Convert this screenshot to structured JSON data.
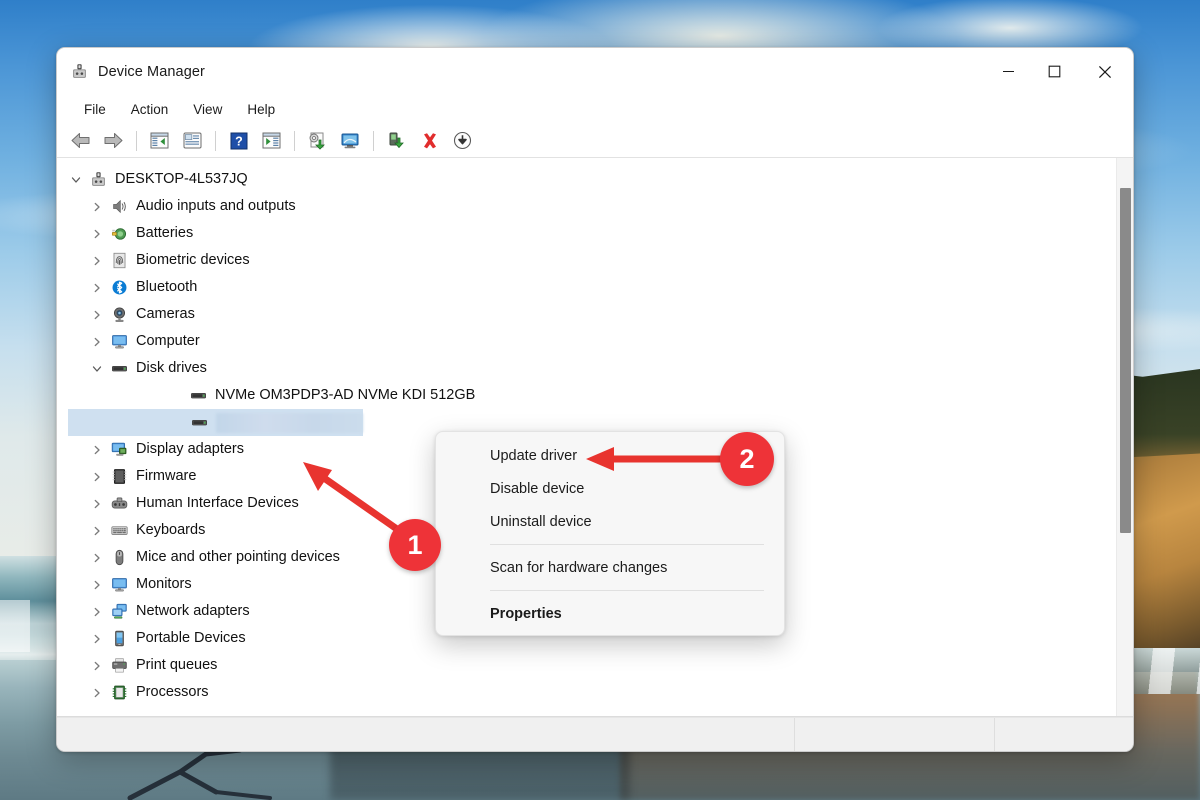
{
  "window": {
    "title": "Device Manager",
    "app_icon": "device-manager-icon",
    "controls": {
      "minimize": "–",
      "maximize": "□",
      "close": "✕"
    }
  },
  "menubar": {
    "items": [
      {
        "label": "File"
      },
      {
        "label": "Action"
      },
      {
        "label": "View"
      },
      {
        "label": "Help"
      }
    ]
  },
  "toolbar": {
    "buttons": [
      {
        "name": "back-icon",
        "title": "Back"
      },
      {
        "name": "forward-icon",
        "title": "Forward"
      },
      {
        "name": "show-hide-console-tree-icon",
        "title": "Show/Hide Console Tree"
      },
      {
        "name": "properties-icon",
        "title": "Properties"
      },
      {
        "name": "help-icon",
        "title": "Help"
      },
      {
        "name": "show-hide-action-pane-icon",
        "title": "Show/Hide Action Pane"
      },
      {
        "name": "update-driver-icon",
        "title": "Update Driver Software"
      },
      {
        "name": "scan-for-hardware-changes-icon",
        "title": "Scan for hardware changes"
      },
      {
        "name": "uninstall-device-icon",
        "title": "Uninstall device"
      },
      {
        "name": "disable-device-icon",
        "title": "Disable device"
      },
      {
        "name": "enable-device-icon",
        "title": "Enable device"
      }
    ]
  },
  "tree": {
    "root": {
      "label": "DESKTOP-4L537JQ",
      "icon": "computer-root-icon",
      "expanded": true
    },
    "nodes": [
      {
        "label": "Audio inputs and outputs",
        "icon": "speaker-icon",
        "expanded": false,
        "level": 1
      },
      {
        "label": "Batteries",
        "icon": "battery-icon",
        "expanded": false,
        "level": 1
      },
      {
        "label": "Biometric devices",
        "icon": "fingerprint-icon",
        "expanded": false,
        "level": 1
      },
      {
        "label": "Bluetooth",
        "icon": "bluetooth-icon",
        "expanded": false,
        "level": 1
      },
      {
        "label": "Cameras",
        "icon": "camera-icon",
        "expanded": false,
        "level": 1
      },
      {
        "label": "Computer",
        "icon": "monitor-icon",
        "expanded": false,
        "level": 1
      },
      {
        "label": "Disk drives",
        "icon": "disk-drive-icon",
        "expanded": true,
        "level": 1
      },
      {
        "label": "NVMe OM3PDP3-AD NVMe KDI 512GB",
        "icon": "disk-drive-icon",
        "level": 2,
        "leaf": true
      },
      {
        "label": "",
        "icon": "disk-drive-icon",
        "level": 2,
        "leaf": true,
        "selected": true,
        "redacted": true
      },
      {
        "label": "Display adapters",
        "icon": "display-adapter-icon",
        "expanded": false,
        "level": 1
      },
      {
        "label": "Firmware",
        "icon": "firmware-chip-icon",
        "expanded": false,
        "level": 1
      },
      {
        "label": "Human Interface Devices",
        "icon": "hid-icon",
        "expanded": false,
        "level": 1
      },
      {
        "label": "Keyboards",
        "icon": "keyboard-icon",
        "expanded": false,
        "level": 1
      },
      {
        "label": "Mice and other pointing devices",
        "icon": "mouse-icon",
        "expanded": false,
        "level": 1
      },
      {
        "label": "Monitors",
        "icon": "monitor-icon",
        "expanded": false,
        "level": 1
      },
      {
        "label": "Network adapters",
        "icon": "network-adapter-icon",
        "expanded": false,
        "level": 1
      },
      {
        "label": "Portable Devices",
        "icon": "portable-device-icon",
        "expanded": false,
        "level": 1
      },
      {
        "label": "Print queues",
        "icon": "printer-icon",
        "expanded": false,
        "level": 1
      },
      {
        "label": "Processors",
        "icon": "processor-icon",
        "expanded": false,
        "level": 1
      }
    ]
  },
  "context_menu": {
    "items": [
      {
        "label": "Update driver",
        "bold": false
      },
      {
        "label": "Disable device",
        "bold": false
      },
      {
        "label": "Uninstall device",
        "bold": false
      },
      {
        "separator": true
      },
      {
        "label": "Scan for hardware changes",
        "bold": false
      },
      {
        "separator": true
      },
      {
        "label": "Properties",
        "bold": true
      }
    ]
  },
  "annotations": {
    "color": "#ee3338",
    "markers": [
      {
        "id": "1",
        "label": "1",
        "points_to": "selected-disk-drive-row"
      },
      {
        "id": "2",
        "label": "2",
        "points_to": "Update driver"
      }
    ]
  },
  "statusbar": {
    "cells": [
      "",
      "",
      ""
    ]
  },
  "colors": {
    "accent_red": "#ee3338",
    "selection_blue": "#cfe0f0",
    "window_bg": "#ffffff",
    "menu_bg": "#f7f7f7",
    "statusbar_bg": "#f0f0f0",
    "scrollbar_thumb": "#8a8a8a"
  }
}
